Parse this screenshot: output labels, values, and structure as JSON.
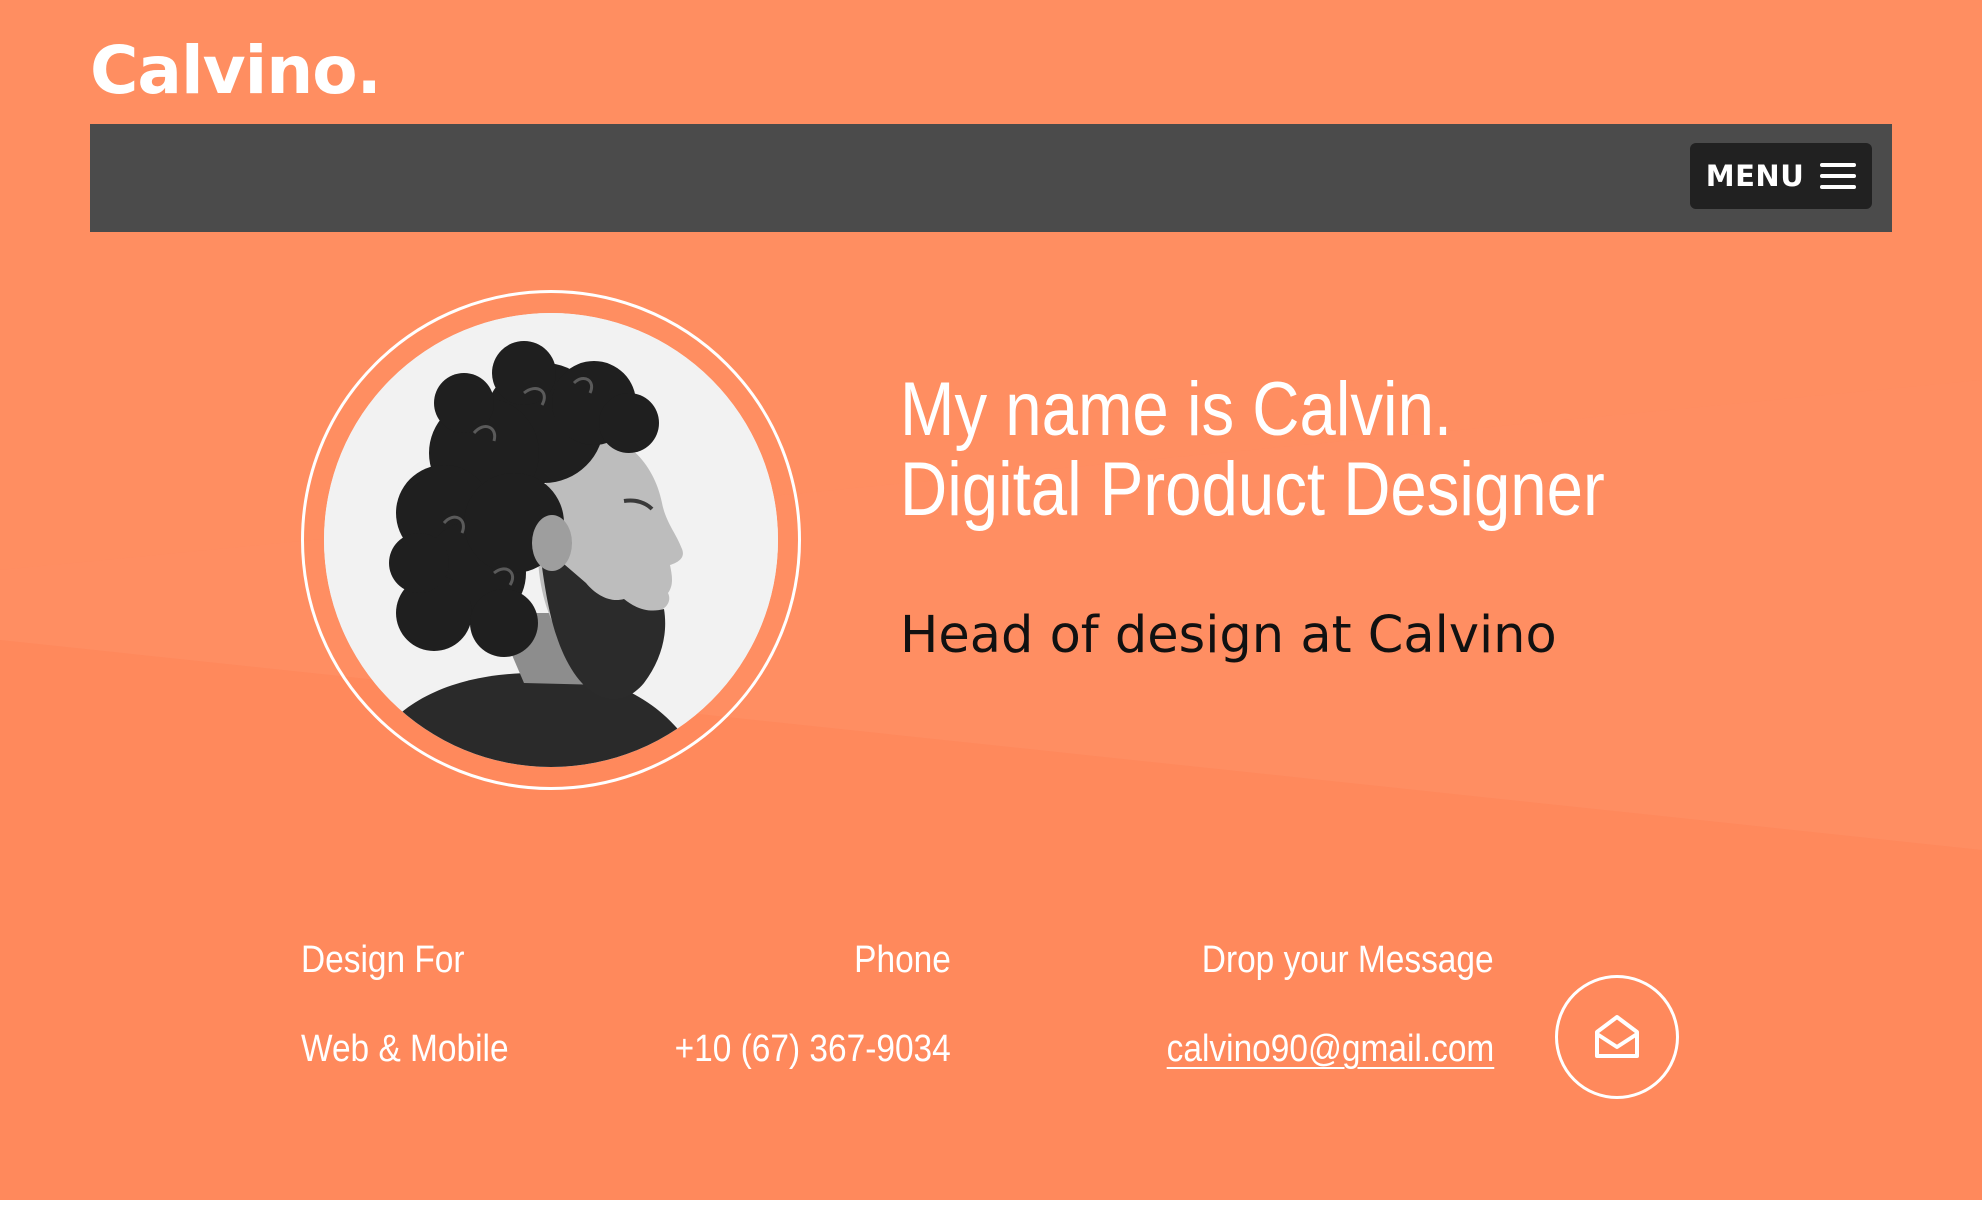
{
  "brand": {
    "logo_text": "Calvino."
  },
  "nav": {
    "menu_label": "MENU"
  },
  "hero": {
    "headline_line1": "My name is Calvin.",
    "headline_line2": "Digital Product Designer",
    "subtitle": "Head of design at Calvino"
  },
  "info": {
    "design_for_label": "Design For",
    "design_for_value": "Web & Mobile",
    "phone_label": "Phone",
    "phone_value": "+10 (67) 367-9034",
    "message_label": "Drop your Message",
    "email_value": "calvino90@gmail.com"
  },
  "icons": {
    "menu": "hamburger-icon",
    "mail": "open-envelope-icon",
    "avatar": "profile-photo"
  },
  "colors": {
    "background": "#ff8a5f",
    "navbar": "#4b4b4b",
    "menu_button": "#212121",
    "text_light": "#ffffff",
    "text_dark": "#111111"
  }
}
